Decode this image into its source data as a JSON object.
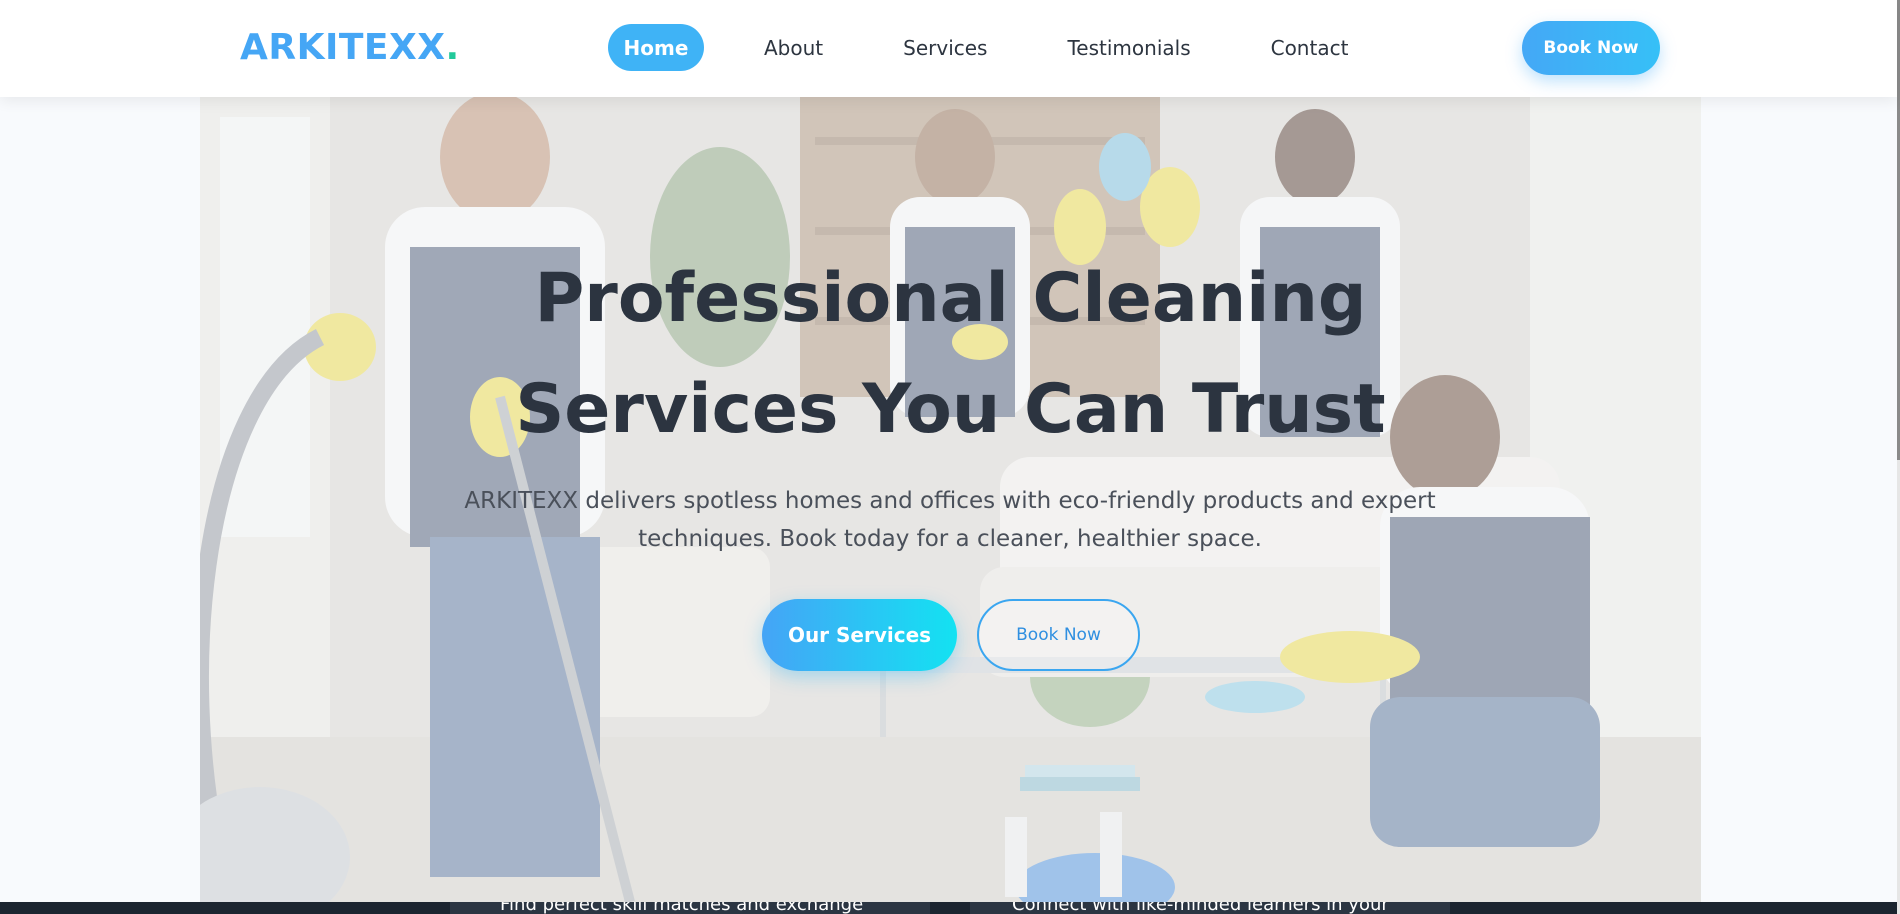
{
  "navbar": {
    "logo_text": "ARKITEXX",
    "logo_dot": ".",
    "links": [
      "Home",
      "About",
      "Services",
      "Testimonials",
      "Contact"
    ],
    "active_link": "Home",
    "cta_label": "Book Now"
  },
  "hero": {
    "title_line1": "Professional Cleaning",
    "title_line2": "Services You Can Trust",
    "subtitle_line1": "ARKITEXX delivers spotless homes and offices with eco-friendly products and expert",
    "subtitle_line2": "techniques. Book today for a cleaner, healthier space.",
    "primary_button": "Our Services",
    "secondary_button": "Book Now"
  },
  "below_fold": {
    "card_text_1": "Find perfect skill matches and exchange",
    "card_text_2": "Connect with like-minded learners in your"
  },
  "colors": {
    "brand_blue": "#45a6f5",
    "logo_dot_green": "#22c99a",
    "text_dark": "#2c3440",
    "gradient_start": "#45a4f6",
    "gradient_end": "#13e2f2"
  }
}
